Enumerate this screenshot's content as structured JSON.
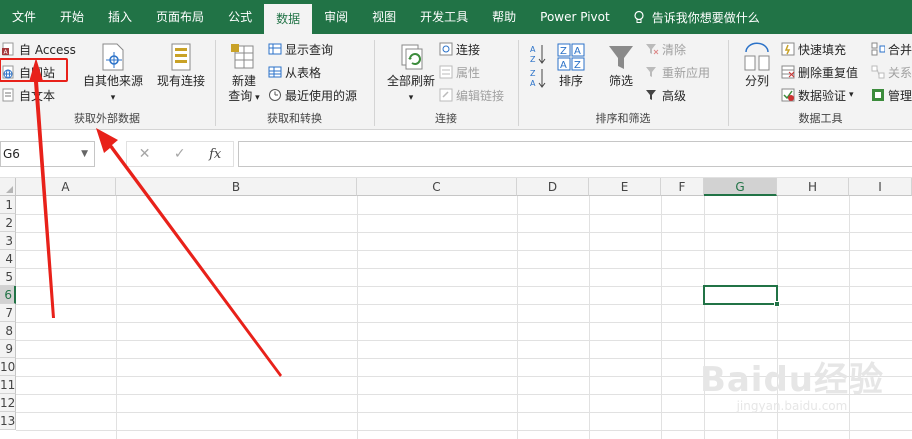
{
  "ribbon_tabs": [
    "文件",
    "开始",
    "插入",
    "页面布局",
    "公式",
    "数据",
    "审阅",
    "视图",
    "开发工具",
    "帮助",
    "Power Pivot"
  ],
  "active_tab": "数据",
  "tell_me": "告诉我你想要做什么",
  "get_external": {
    "access": "自 Access",
    "web": "自网站",
    "text": "自文本",
    "other_sources": "自其他来源",
    "existing": "现有连接",
    "label": "获取外部数据"
  },
  "get_transform": {
    "new_query_1": "新建",
    "new_query_2": "查询",
    "show_queries": "显示查询",
    "from_table": "从表格",
    "recent_sources": "最近使用的源",
    "label": "获取和转换"
  },
  "connections": {
    "refresh_all": "全部刷新",
    "connections": "连接",
    "properties": "属性",
    "edit_links": "编辑链接",
    "label": "连接"
  },
  "sort_filter": {
    "sort": "排序",
    "filter": "筛选",
    "clear": "清除",
    "reapply": "重新应用",
    "advanced": "高级",
    "label": "排序和筛选"
  },
  "data_tools": {
    "text_to_columns": "分列",
    "flash_fill": "快速填充",
    "remove_duplicates": "删除重复值",
    "data_validation": "数据验证",
    "consolidate": "合并",
    "relationships": "关系",
    "manage": "管理",
    "label": "数据工具"
  },
  "name_box": "G6",
  "formula_fx": "fx",
  "formula_value": "",
  "columns": [
    "A",
    "B",
    "C",
    "D",
    "E",
    "F",
    "G",
    "H",
    "I"
  ],
  "selected_column": "G",
  "rows": [
    "1",
    "2",
    "3",
    "4",
    "5",
    "6",
    "7",
    "8",
    "9",
    "10",
    "11",
    "12",
    "13"
  ],
  "selected_row": "6",
  "watermark": {
    "logo": "Baidu经验",
    "url": "jingyan.baidu.com"
  },
  "colors": {
    "ribbon_green": "#217346",
    "annotation_red": "#e8211a"
  }
}
